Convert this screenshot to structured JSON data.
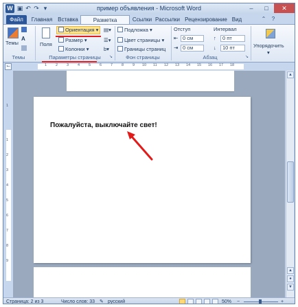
{
  "window": {
    "title": "пример объявления - Microsoft Word",
    "word_icon": "W",
    "quick_access": [
      "save-icon",
      "undo-icon",
      "redo-icon",
      "customize-icon"
    ],
    "controls": [
      "minimize",
      "maximize",
      "close"
    ]
  },
  "tabs": [
    {
      "label": "Файл"
    },
    {
      "label": "Главная"
    },
    {
      "label": "Вставка"
    },
    {
      "label": "Разметка страницы"
    },
    {
      "label": "Ссылки"
    },
    {
      "label": "Рассылки"
    },
    {
      "label": "Рецензирование"
    },
    {
      "label": "Вид"
    }
  ],
  "ribbon": {
    "themes": {
      "button": "Темы",
      "group_label": "Темы"
    },
    "page_setup": {
      "fields": "Поля",
      "orientation": "Ориентация",
      "size": "Размер",
      "columns": "Колонки",
      "group_label": "Параметры страницы"
    },
    "page_background": {
      "watermark": "Подложка",
      "page_color": "Цвет страницы",
      "page_borders": "Границы страниц",
      "group_label": "Фон страницы"
    },
    "paragraph": {
      "indent_label": "Отступ",
      "spacing_label": "Интервал",
      "indent_left": "0 см",
      "indent_right": "0 см",
      "spacing_before": "0 пт",
      "spacing_after": "10 пт",
      "group_label": "Абзац"
    },
    "arrange": {
      "label": "Упорядочить"
    },
    "accent_color": "#ffe38c",
    "underline_color": "#e11a1a"
  },
  "document": {
    "text": "Пожалуйста, выключайте свет!"
  },
  "status": {
    "page": "Страница: 2 из 3",
    "words": "Число слов: 33",
    "language": "русский",
    "zoom": "50%"
  }
}
